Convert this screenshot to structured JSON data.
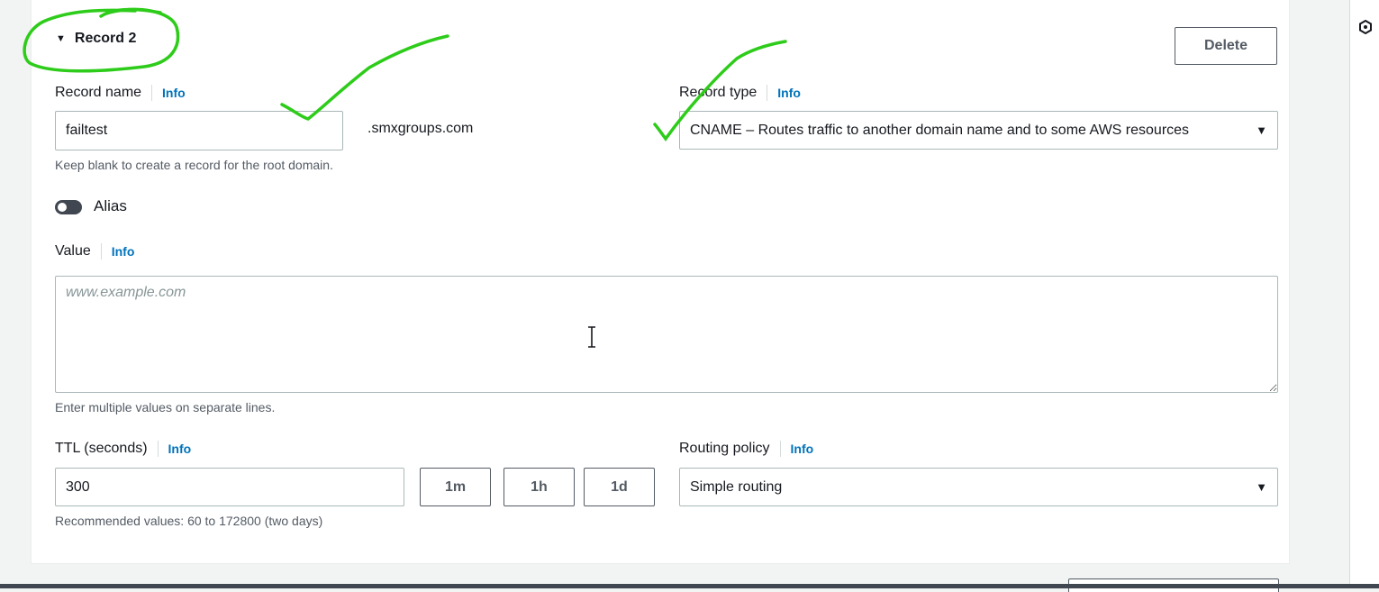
{
  "record": {
    "title": "Record 2",
    "delete_label": "Delete"
  },
  "record_name": {
    "label": "Record name",
    "info": "Info",
    "value": "failtest",
    "suffix": ".smxgroups.com",
    "hint": "Keep blank to create a record for the root domain."
  },
  "record_type": {
    "label": "Record type",
    "info": "Info",
    "selected": "CNAME – Routes traffic to another domain name and to some AWS resources"
  },
  "alias": {
    "label": "Alias",
    "enabled": false
  },
  "value": {
    "label": "Value",
    "info": "Info",
    "placeholder": "www.example.com",
    "hint": "Enter multiple values on separate lines."
  },
  "ttl": {
    "label": "TTL (seconds)",
    "info": "Info",
    "value": "300",
    "hint": "Recommended values: 60 to 172800 (two days)",
    "presets": [
      "1m",
      "1h",
      "1d"
    ]
  },
  "routing_policy": {
    "label": "Routing policy",
    "info": "Info",
    "selected": "Simple routing"
  },
  "colors": {
    "accent_link": "#0073bb",
    "annotation_green": "#2ecc1a"
  },
  "icons": {
    "record_caret": "caret-down-icon",
    "select_caret": "caret-down-icon",
    "rail": "hexagon-icon"
  }
}
